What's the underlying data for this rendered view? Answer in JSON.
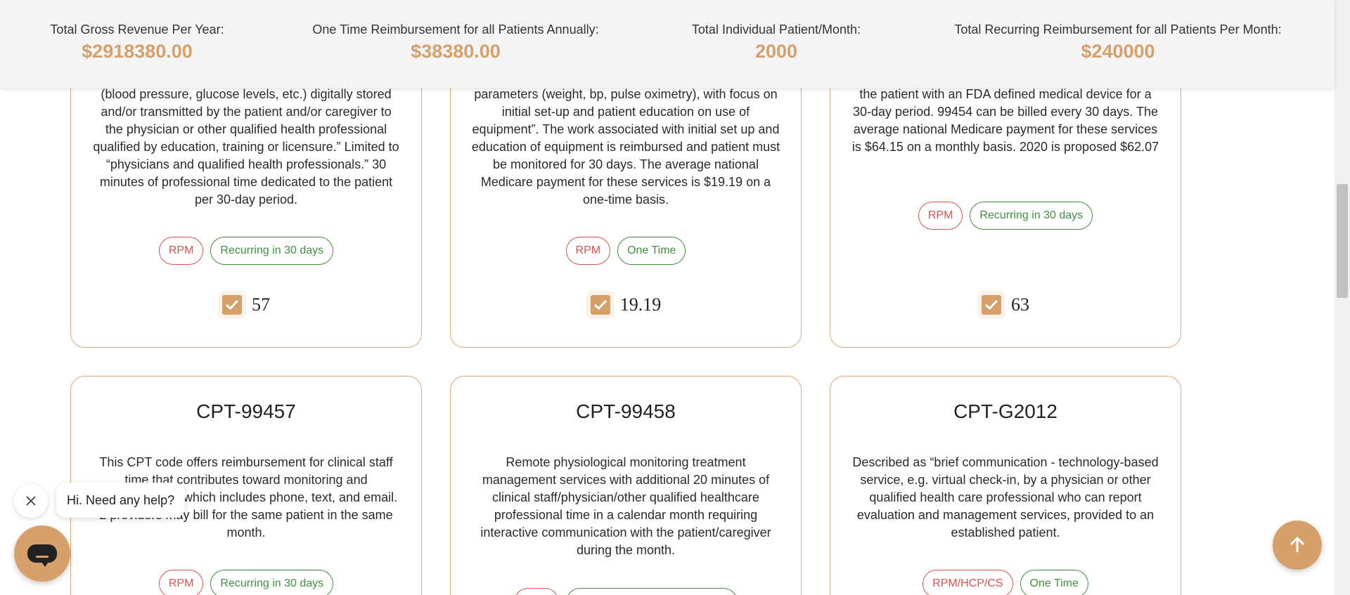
{
  "summary": {
    "gross_revenue_label": "Total Gross Revenue Per Year:",
    "gross_revenue_value": "$2918380.00",
    "one_time_label": "One Time Reimbursement for all Patients Annually:",
    "one_time_value": "$38380.00",
    "patients_label": "Total Individual Patient/Month:",
    "patients_value": "2000",
    "recurring_label": "Total Recurring Reimbursement for all Patients Per Month:",
    "recurring_value": "$240000"
  },
  "cards_top": [
    {
      "description": "(blood pressure, glucose levels, etc.) digitally stored and/or transmitted by the patient and/or caregiver to the physician or other qualified health professional qualified by education, training or licensure.” Limited to “physicians and qualified health professionals.” 30 minutes of professional time dedicated to the patient per 30-day period.",
      "tags": [
        "RPM",
        "Recurring in 30 days"
      ],
      "price": "57"
    },
    {
      "description": "parameters (weight, bp, pulse oximetry), with focus on initial set-up and patient education on use of equipment”. The work associated with initial set up and education of equipment is reimbursed and patient must be monitored for 30 days. The average national Medicare payment for these services is $19.19 on a one-time basis.",
      "tags": [
        "RPM",
        "One Time"
      ],
      "price": "19.19"
    },
    {
      "description": "the patient with an FDA defined medical device for a 30-day period. 99454 can be billed every 30 days. The average national Medicare payment for these services is $64.15 on a monthly basis. 2020 is proposed $62.07",
      "tags": [
        "RPM",
        "Recurring in 30 days"
      ],
      "price": "63"
    }
  ],
  "cards_bottom": [
    {
      "title": "CPT-99457",
      "description": "This CPT code offers reimbursement for clinical staff time that contributes toward monitoring and communication which includes phone, text, and email. 2 providers may bill for the same patient in the same month.",
      "tags": [
        "RPM",
        "Recurring in 30 days"
      ]
    },
    {
      "title": "CPT-99458",
      "description": "Remote physiological monitoring treatment management services with additional 20 minutes of clinical staff/physician/other qualified healthcare professional time in a calendar month requiring interactive communication with the patient/caregiver during the month."
    },
    {
      "title": "CPT-G2012",
      "description": "Described as “brief communication - technology-based service, e.g. virtual check-in, by a physician or other qualified health care professional who can report evaluation and management services, provided to an established patient.",
      "tags": [
        "RPM/HCP/CS",
        "One Time"
      ]
    }
  ],
  "chat": {
    "greeting": "Hi. Need any help?"
  },
  "colors": {
    "accent": "#d5a06a",
    "tag_red": "#d9534f",
    "tag_green": "#3f8f3f",
    "card_border": "#e0a77a"
  },
  "icons": [
    "check-icon",
    "close-icon",
    "chat-icon",
    "arrow-up-icon"
  ]
}
